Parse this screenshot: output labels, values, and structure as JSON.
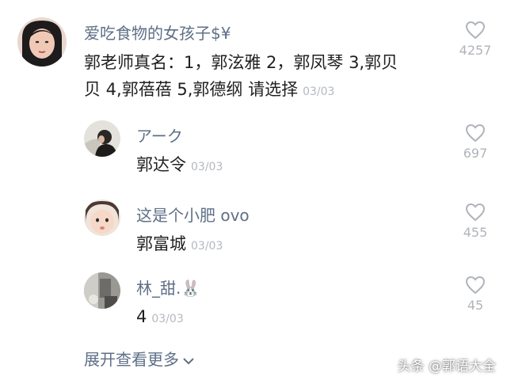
{
  "comments": [
    {
      "username": "爱吃食物的女孩子$¥",
      "text_line1": "郭老师真名：1，郭泫雅 2，郭凤琴 3,郭贝",
      "text_line2": "贝 4,郭蓓蓓 5,郭德纲 请选择",
      "date": "03/03",
      "likes": "4257",
      "avatar_icon": "woman-face-avatar"
    }
  ],
  "replies": [
    {
      "username": "アーク",
      "text": "郭达令",
      "date": "03/03",
      "likes": "697",
      "avatar_icon": "person-avatar"
    },
    {
      "username": "这是个小肥 ovo",
      "text": "郭富城",
      "date": "03/03",
      "likes": "455",
      "avatar_icon": "child-face-avatar"
    },
    {
      "username": "林_甜.🐰",
      "text": "4",
      "date": "03/03",
      "likes": "45",
      "avatar_icon": "room-photo-avatar"
    }
  ],
  "expand": {
    "label": "展开查看更多",
    "icon": "chevron-down-icon"
  },
  "watermark": {
    "text": "头条 @郭语大全"
  },
  "colors": {
    "username": "#5f6f86",
    "text": "#1f1f1f",
    "meta": "#b4b8bf",
    "background": "#ffffff"
  }
}
